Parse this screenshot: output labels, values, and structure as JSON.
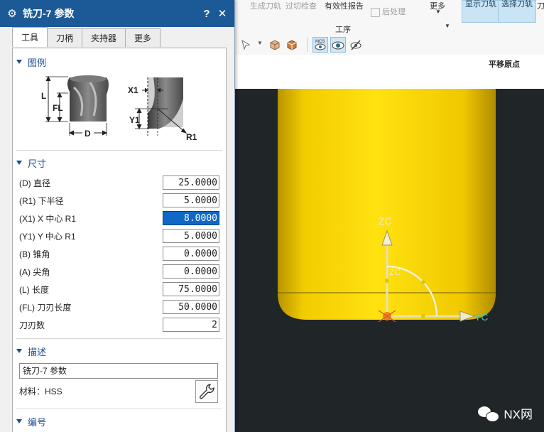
{
  "ribbon": {
    "group_label": "工序",
    "report_label": "有效性报告",
    "postprocess_label": "后处理",
    "more_label": "更多",
    "display_toolpath": "显示刀轨",
    "select_toolpath": "选择刀轨",
    "faded_left": "生成刀轨",
    "faded_mid": "过切检查",
    "truncated_right": "刀"
  },
  "band": {
    "label": "平移原点"
  },
  "viewport": {
    "axis_zc": "ZC",
    "axis_yc": "YC",
    "arc_zc": "ZC",
    "tool_color": "#ffdd00",
    "background": "#202528"
  },
  "watermark": {
    "text": "NX网"
  },
  "dialog": {
    "title": "铣刀-7 参数",
    "help_button": "?",
    "close_button": "✕",
    "tabs": [
      {
        "label": "工具",
        "active": true
      },
      {
        "label": "刀柄",
        "active": false
      },
      {
        "label": "夹持器",
        "active": false
      },
      {
        "label": "更多",
        "active": false
      }
    ],
    "sections": {
      "legend": "图例",
      "dimensions": "尺寸",
      "description": "描述",
      "numbering": "编号"
    },
    "diagram_labels": {
      "L": "L",
      "FL": "FL",
      "D": "D",
      "X1": "X1",
      "Y1": "Y1",
      "R1": "R1"
    },
    "dimensions": [
      {
        "label": "(D) 直径",
        "value": "25.0000",
        "selected": false
      },
      {
        "label": "(R1) 下半径",
        "value": "5.0000",
        "selected": false
      },
      {
        "label": "(X1) X 中心 R1",
        "value": "8.0000",
        "selected": true
      },
      {
        "label": "(Y1) Y 中心 R1",
        "value": "5.0000",
        "selected": false
      },
      {
        "label": "(B) 锥角",
        "value": "0.0000",
        "selected": false
      },
      {
        "label": "(A) 尖角",
        "value": "0.0000",
        "selected": false
      },
      {
        "label": "(L) 长度",
        "value": "75.0000",
        "selected": false
      },
      {
        "label": "(FL) 刀刃长度",
        "value": "50.0000",
        "selected": false
      },
      {
        "label": "刀刃数",
        "value": "2",
        "selected": false
      }
    ],
    "description_value": "铣刀-7 参数",
    "material": "材料：HSS"
  }
}
